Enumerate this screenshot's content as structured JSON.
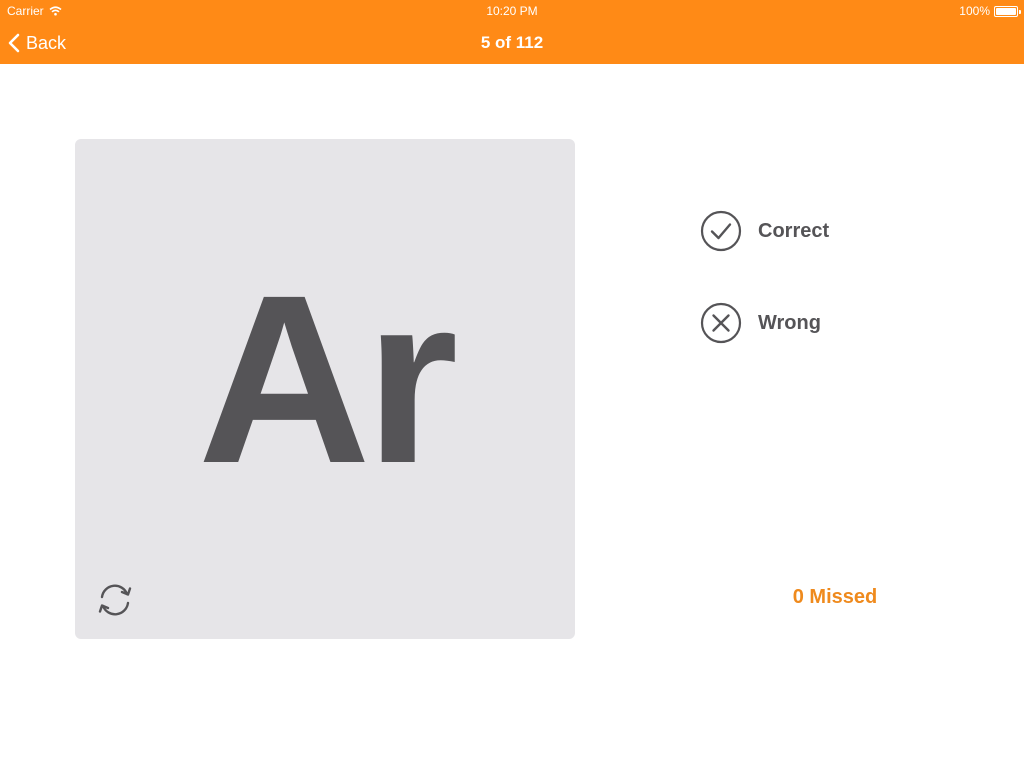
{
  "status_bar": {
    "carrier": "Carrier",
    "time": "10:20 PM",
    "battery": "100%"
  },
  "nav": {
    "back_label": "Back",
    "title": "5 of 112"
  },
  "card": {
    "symbol": "Ar"
  },
  "answers": {
    "correct_label": "Correct",
    "wrong_label": "Wrong"
  },
  "missed": "0 Missed",
  "colors": {
    "accent": "#ff8a16",
    "text": "#555457",
    "card_bg": "#e6e5e8",
    "missed": "#ef8a1d"
  },
  "icons": {
    "wifi": "wifi-icon",
    "battery": "battery-icon",
    "back": "chevron-left-icon",
    "flip": "refresh-icon",
    "correct": "check-circle-icon",
    "wrong": "x-circle-icon"
  }
}
